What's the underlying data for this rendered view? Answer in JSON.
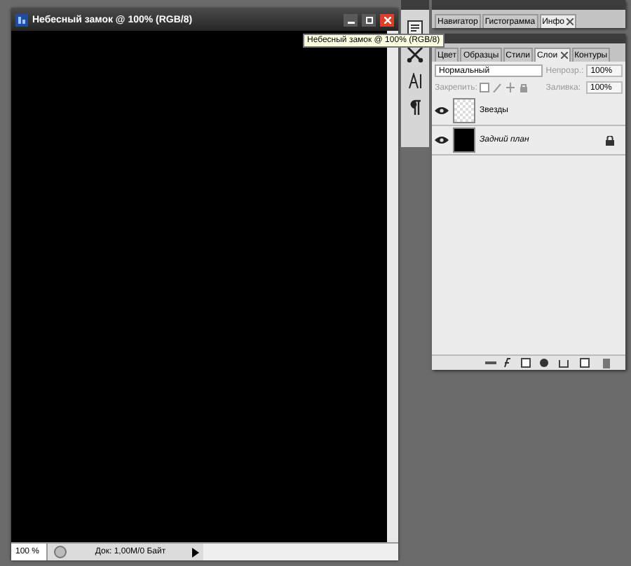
{
  "document": {
    "title": "Небесный замок @ 100% (RGB/8)",
    "zoom": "100 %",
    "doc_info": "Док: 1,00M/0 Байт"
  },
  "tooltip": "Небесный замок @ 100% (RGB/8)",
  "top_panel": {
    "tabs": [
      {
        "label": "Навигатор",
        "selected": false,
        "closable": false
      },
      {
        "label": "Гистограмма",
        "selected": false,
        "closable": false
      },
      {
        "label": "Инфо",
        "selected": true,
        "closable": true
      }
    ]
  },
  "layers_panel": {
    "tabs": [
      {
        "label": "Цвет",
        "selected": false,
        "closable": false
      },
      {
        "label": "Образцы",
        "selected": false,
        "closable": false
      },
      {
        "label": "Стили",
        "selected": false,
        "closable": false
      },
      {
        "label": "Слои",
        "selected": true,
        "closable": true
      },
      {
        "label": "Контуры",
        "selected": false,
        "closable": false
      }
    ],
    "blend_mode": "Нормальный",
    "opacity_label": "Непрозр.:",
    "opacity": "100%",
    "lock_label": "Закрепить:",
    "fill_label": "Заливка:",
    "fill": "100%",
    "layers": [
      {
        "name": "Звезды",
        "kind": "transparent",
        "visible": true,
        "locked": false
      },
      {
        "name": "Задний план",
        "kind": "black",
        "visible": true,
        "locked": true
      }
    ]
  }
}
